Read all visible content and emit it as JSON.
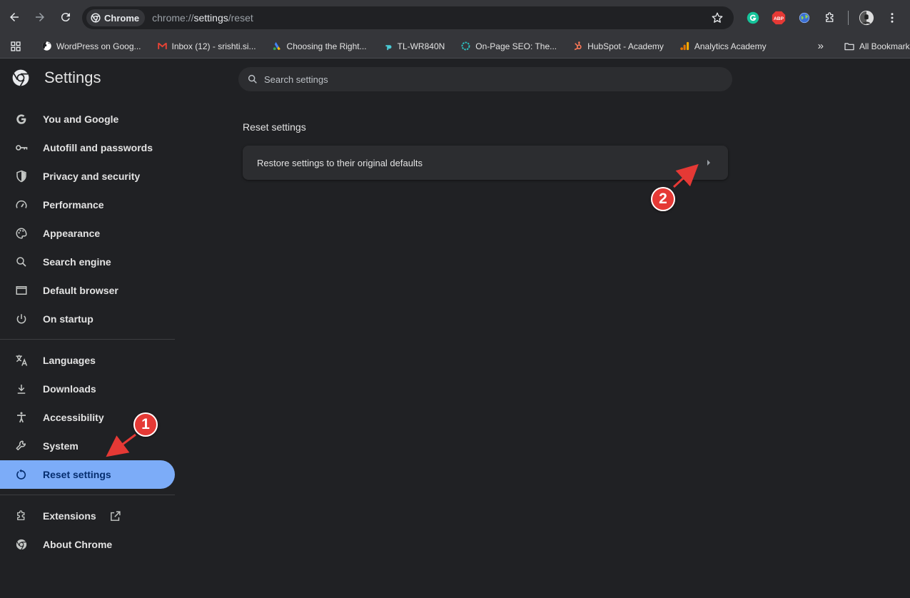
{
  "toolbar": {
    "chip_label": "Chrome",
    "url_scheme": "chrome://",
    "url_host": "settings",
    "url_path": "/reset",
    "icons": [
      "back-icon",
      "forward-icon",
      "reload-icon",
      "star-icon",
      "grammarly-icon",
      "adblock-plus-icon",
      "extension-globe-icon",
      "extensions-puzzle-icon",
      "profile-avatar",
      "menu-kebab-icon"
    ],
    "abp_label": "ABP"
  },
  "bookmarks": {
    "items": [
      {
        "label": "WordPress on Goog...",
        "icon": "globe-icon"
      },
      {
        "label": "Inbox (12) - srishti.si...",
        "icon": "gmail-icon"
      },
      {
        "label": "Choosing the Right...",
        "icon": "google-ads-icon"
      },
      {
        "label": "TL-WR840N",
        "icon": "tplink-icon"
      },
      {
        "label": "On-Page SEO: The...",
        "icon": "circle-icon"
      },
      {
        "label": "HubSpot - Academy",
        "icon": "hubspot-icon"
      },
      {
        "label": "Analytics Academy",
        "icon": "analytics-icon"
      }
    ],
    "overflow": "»",
    "all_bookmarks": "All Bookmarks"
  },
  "sidebar": {
    "title": "Settings",
    "items": [
      {
        "label": "You and Google",
        "icon": "google-g-icon"
      },
      {
        "label": "Autofill and passwords",
        "icon": "key-icon"
      },
      {
        "label": "Privacy and security",
        "icon": "shield-icon"
      },
      {
        "label": "Performance",
        "icon": "gauge-icon"
      },
      {
        "label": "Appearance",
        "icon": "palette-icon"
      },
      {
        "label": "Search engine",
        "icon": "search-icon"
      },
      {
        "label": "Default browser",
        "icon": "browser-window-icon"
      },
      {
        "label": "On startup",
        "icon": "power-icon"
      }
    ],
    "items2": [
      {
        "label": "Languages",
        "icon": "translate-icon"
      },
      {
        "label": "Downloads",
        "icon": "download-icon"
      },
      {
        "label": "Accessibility",
        "icon": "accessibility-icon"
      },
      {
        "label": "System",
        "icon": "wrench-icon"
      },
      {
        "label": "Reset settings",
        "icon": "reset-icon",
        "active": true
      }
    ],
    "items3": [
      {
        "label": "Extensions",
        "icon": "puzzle-icon"
      },
      {
        "label": "About Chrome",
        "icon": "chrome-icon"
      }
    ]
  },
  "main": {
    "search_placeholder": "Search settings",
    "section_title": "Reset settings",
    "restore_label": "Restore settings to their original defaults"
  },
  "annotations": {
    "badge1": "1",
    "badge2": "2",
    "color": "#e53935"
  }
}
